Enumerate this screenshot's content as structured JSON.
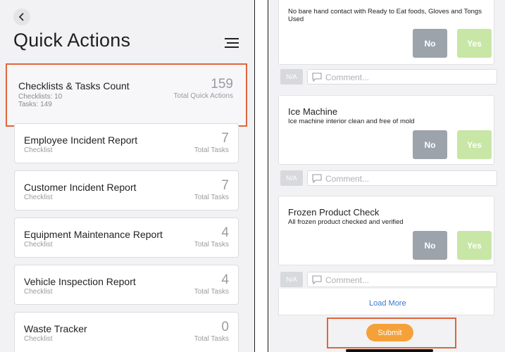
{
  "left": {
    "title": "Quick Actions",
    "summary": {
      "title": "Checklists & Tasks Count",
      "checklists": "Checklists: 10",
      "tasks": "Tasks: 149",
      "count": "159",
      "count_label": "Total Quick Actions"
    },
    "items": [
      {
        "title": "Employee Incident Report",
        "type": "Checklist",
        "count": "7",
        "count_label": "Total Tasks"
      },
      {
        "title": "Customer Incident Report",
        "type": "Checklist",
        "count": "7",
        "count_label": "Total Tasks"
      },
      {
        "title": "Equipment Maintenance Report",
        "type": "Checklist",
        "count": "4",
        "count_label": "Total Tasks"
      },
      {
        "title": "Vehicle Inspection Report",
        "type": "Checklist",
        "count": "4",
        "count_label": "Total Tasks"
      },
      {
        "title": "Waste Tracker",
        "type": "Checklist",
        "count": "0",
        "count_label": "Total Tasks"
      }
    ],
    "icons": {
      "back": "chevron-left-icon",
      "menu": "menu-icon"
    }
  },
  "right": {
    "checks": [
      {
        "title": "",
        "desc": "No bare hand contact with Ready to Eat foods, Gloves and Tongs Used"
      },
      {
        "title": "Ice Machine",
        "desc": "Ice machine interior clean and free of mold"
      },
      {
        "title": "Frozen Product Check",
        "desc": "All frozen product checked and verified"
      }
    ],
    "no_label": "No",
    "yes_label": "Yes",
    "na_label": "N/A",
    "comment_placeholder": "Comment...",
    "load_more": "Load More",
    "submit": "Submit"
  },
  "colors": {
    "highlight": "#e0653b",
    "no_button": "#9ca3ab",
    "yes_button": "#c8e6a6",
    "submit": "#f5a13a",
    "link": "#3a78c9"
  }
}
